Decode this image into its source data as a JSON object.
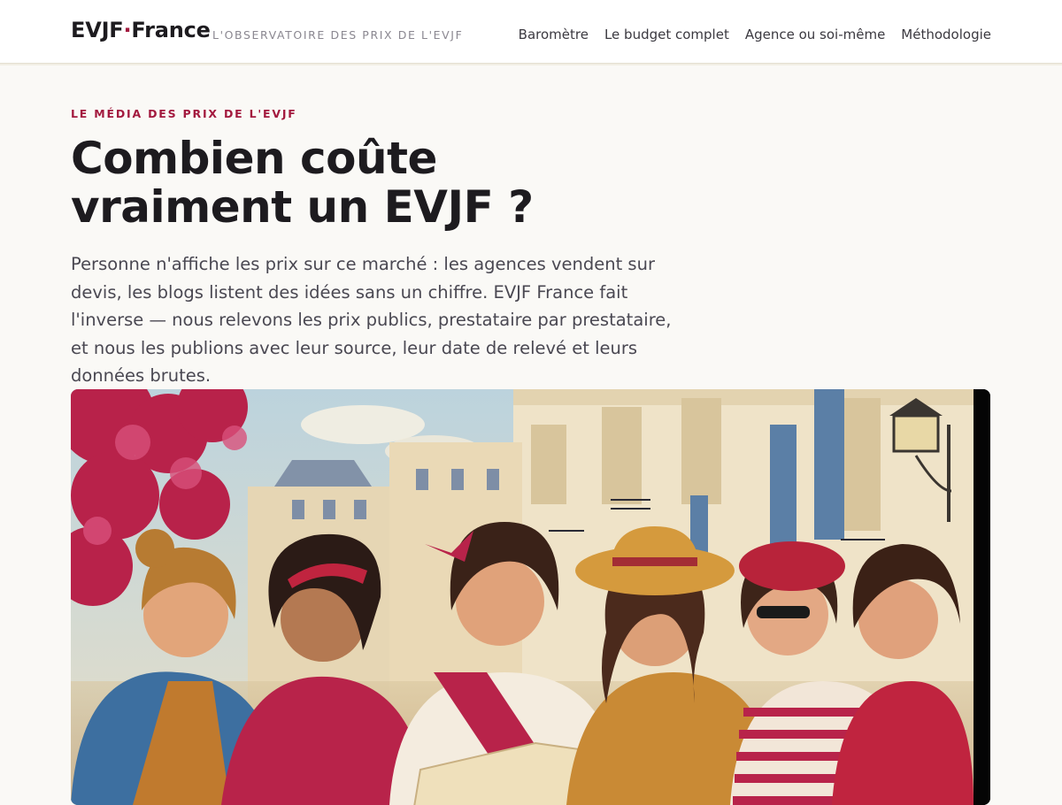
{
  "header": {
    "logo_part1": "EVJF",
    "logo_dot": "·",
    "logo_part2": "France",
    "tagline": "L'OBSERVATOIRE DES PRIX DE L'EVJF",
    "nav": [
      {
        "label": "Baromètre"
      },
      {
        "label": "Le budget complet"
      },
      {
        "label": "Agence ou soi-même"
      },
      {
        "label": "Méthodologie"
      }
    ]
  },
  "hero": {
    "eyebrow": "LE MÉDIA DES PRIX DE L'EVJF",
    "title_line1": "Combien coûte",
    "title_line2": "vraiment un EVJF ?",
    "lead": "Personne n'affiche les prix sur ce marché : les agences vendent sur devis, les blogs listent des idées sans un chiffre. EVJF France fait l'inverse — nous relevons les prix publics, prestataire par prestataire, et nous les publions avec leur source, leur date de relevé et leurs données brutes."
  },
  "colors": {
    "accent": "#a3193e",
    "text": "#1d1b1f",
    "muted": "#4a4852",
    "background": "#faf9f6"
  }
}
